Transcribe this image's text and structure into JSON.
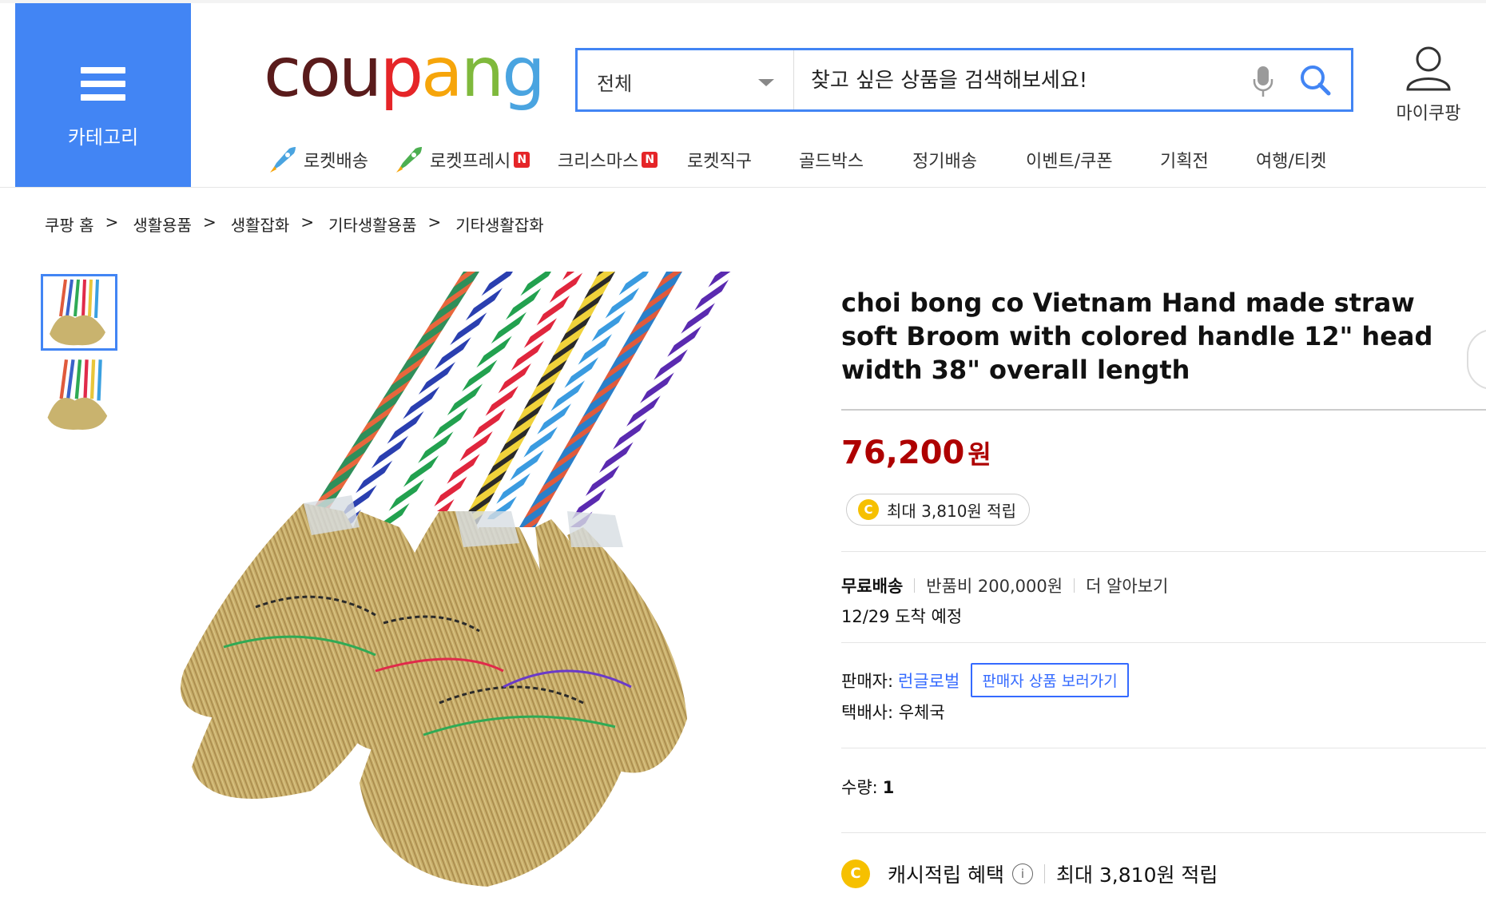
{
  "header": {
    "category_label": "카테고리",
    "logo_text": [
      "c",
      "o",
      "u",
      "p",
      "a",
      "n",
      "g"
    ],
    "logo_colors": [
      "#5a1b1b",
      "#5a1b1b",
      "#5a1b1b",
      "#e52528",
      "#f6a50b",
      "#7fb93c",
      "#4aa4e0"
    ],
    "search": {
      "category_value": "전체",
      "placeholder": "찾고 싶은 상품을 검색해보세요!"
    },
    "my_coupang_label": "마이쿠팡",
    "nav": [
      {
        "label": "로켓배송",
        "icon": "rocket-icon"
      },
      {
        "label": "로켓프레시",
        "icon": "rocket-green-icon",
        "badge": "N"
      },
      {
        "label": "크리스마스",
        "badge": "N"
      },
      {
        "label": "로켓직구"
      },
      {
        "label": "골드박스"
      },
      {
        "label": "정기배송"
      },
      {
        "label": "이벤트/쿠폰"
      },
      {
        "label": "기획전"
      },
      {
        "label": "여행/티켓"
      }
    ]
  },
  "breadcrumb": {
    "items": [
      "쿠팡 홈",
      "생활용품",
      "생활잡화",
      "기타생활용품",
      "기타생활잡화"
    ],
    "separator": ">"
  },
  "product": {
    "title": "choi bong co Vietnam Hand made straw soft Broom with colored handle 12\" head width 38\" overall length",
    "price": "76,200",
    "price_unit": "원",
    "reward_badge": "최대 3,810원 적립",
    "coin_letter": "C",
    "shipping": {
      "free": "무료배송",
      "return_fee": "반품비 200,000원",
      "more": "더 알아보기",
      "arrival": "12/29 도착 예정"
    },
    "seller_label": "판매자:",
    "seller_name": "런글로벌",
    "seller_button": "판매자 상품 보러가기",
    "courier": "택배사: 우체국",
    "quantity_label": "수량:",
    "quantity_value": "1",
    "cash_label": "캐시적립 혜택",
    "cash_info": "i",
    "cash_value": "최대 3,810원 적립"
  },
  "colors": {
    "accent": "#4285f4",
    "price": "#ae0000",
    "link": "#346aff",
    "coin": "#f6c000"
  }
}
